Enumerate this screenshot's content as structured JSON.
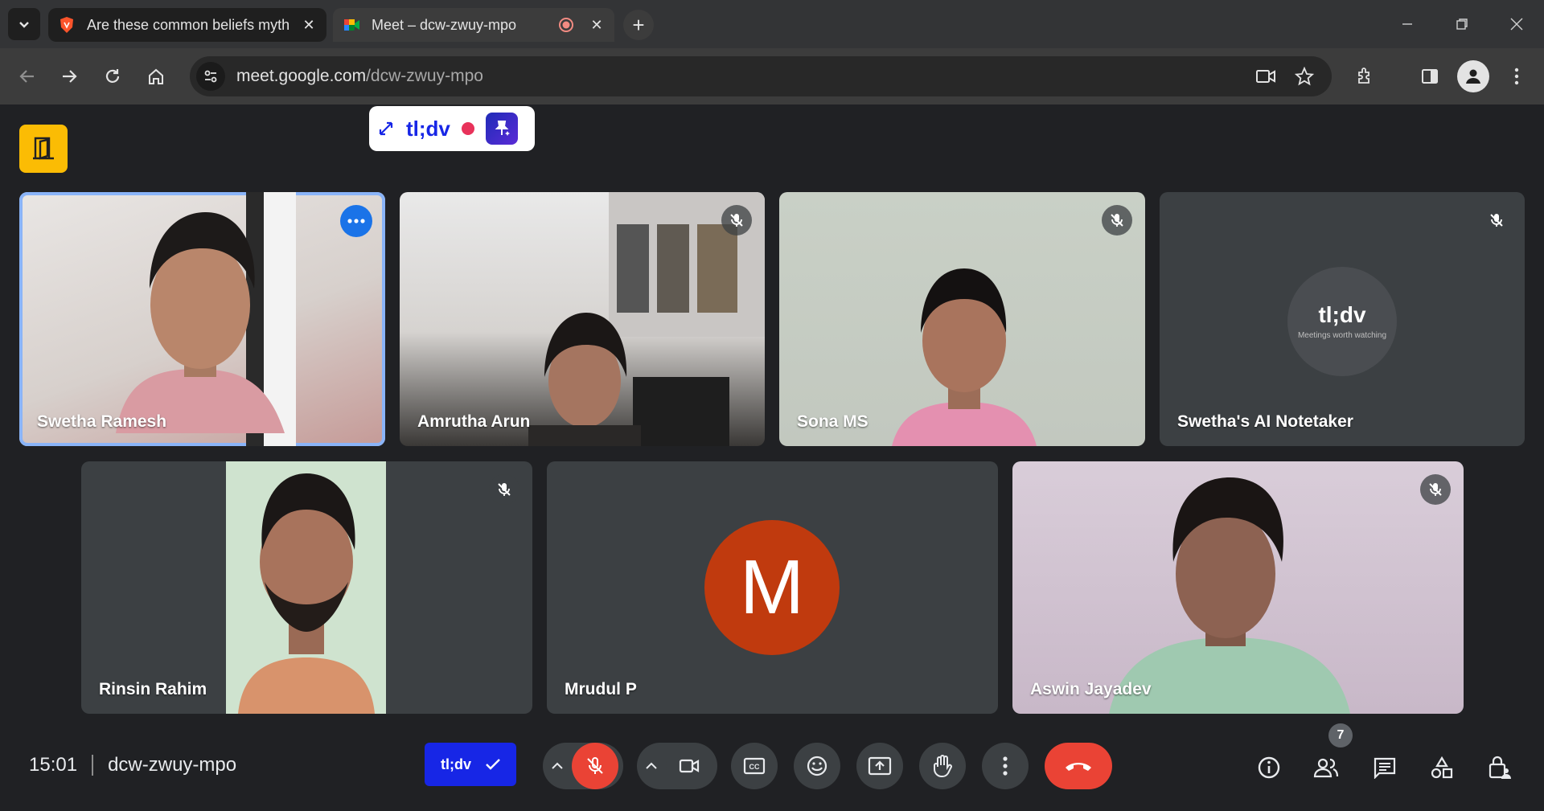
{
  "browser": {
    "tabs": [
      {
        "title": "Are these common beliefs myth",
        "active": false
      },
      {
        "title": "Meet – dcw-zwuy-mpo",
        "active": true,
        "recording": true
      }
    ],
    "url_host": "meet.google.com",
    "url_path": "/dcw-zwuy-mpo"
  },
  "tldv_pill": {
    "logo": "tl;dv"
  },
  "participants": {
    "p1": {
      "name": "Swetha Ramesh"
    },
    "p2": {
      "name": "Amrutha Arun"
    },
    "p3": {
      "name": "Sona MS"
    },
    "p4": {
      "name": "Swetha's AI Notetaker",
      "avatar_logo": "tl;dv",
      "avatar_tagline": "Meetings worth watching"
    },
    "p5": {
      "name": "Rinsin Rahim"
    },
    "p6": {
      "name": "Mrudul P",
      "initial": "M"
    },
    "p7": {
      "name": "Aswin Jayadev"
    }
  },
  "controls": {
    "time": "15:01",
    "meeting_code": "dcw-zwuy-mpo",
    "tldv_label": "tl;dv",
    "people_count": "7"
  },
  "colors": {
    "accent": "#8ab4f8",
    "end_call": "#ea4335",
    "tldv_blue": "#1726e6",
    "avatar_m": "#c03a0e"
  }
}
